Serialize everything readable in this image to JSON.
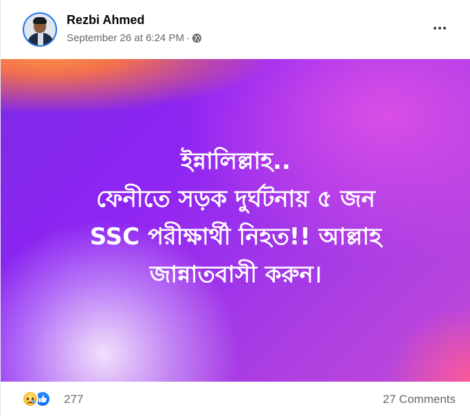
{
  "post": {
    "author": "Rezbi Ahmed",
    "timestamp": "September 26 at 6:24 PM",
    "meta_separator": "·",
    "privacy_icon": "globe-icon",
    "more_icon": "more-horizontal-icon",
    "text": "ইন্নালিল্লাহ..\nফেনীতে সড়ক দুর্ঘটনায় ৫ জন\nSSC পরীক্ষার্থী নিহত!! আল্লাহ\nজান্নাতবাসী করুন।",
    "background_colors": {
      "primary": "#8f25f2",
      "accent_orange": "#ff9646",
      "accent_pink": "#ff5a96"
    }
  },
  "footer": {
    "reactions": [
      "sad-icon",
      "like-icon"
    ],
    "reaction_count": "277",
    "comments_label": "27 Comments"
  },
  "colors": {
    "name": "#050505",
    "meta": "#65676b",
    "like_blue": "#0866ff"
  }
}
